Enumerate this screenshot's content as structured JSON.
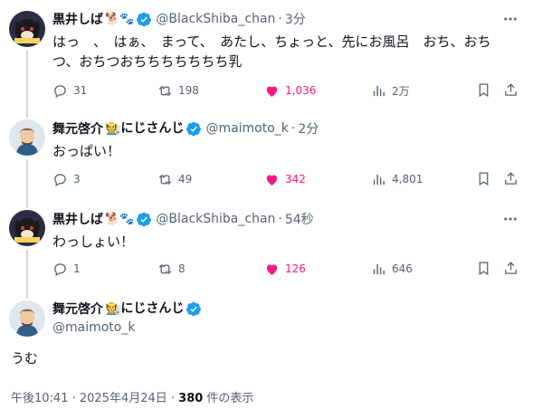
{
  "tweets": [
    {
      "name": "黒井しば",
      "emojis": "🐕🐾",
      "handle": "@BlackShiba_chan",
      "time": "3分",
      "text": "はっ　、　はぁ、　まって、　あたし、ちょっと、先にお風呂　おち、おちつ、おちつおちちちちちちち乳",
      "reply": "31",
      "retweet": "198",
      "like": "1,036",
      "views": "2万"
    },
    {
      "name": "舞元啓介",
      "emojis": "🧑‍🌾にじさんじ",
      "handle": "@maimoto_k",
      "time": "2分",
      "text": "おっぱい！",
      "reply": "3",
      "retweet": "49",
      "like": "342",
      "views": "4,801"
    },
    {
      "name": "黒井しば",
      "emojis": "🐕🐾",
      "handle": "@BlackShiba_chan",
      "time": "54秒",
      "text": "わっしょい！",
      "reply": "1",
      "retweet": "8",
      "like": "126",
      "views": "646"
    }
  ],
  "main": {
    "name": "舞元啓介",
    "emojis": "🧑‍🌾にじさんじ",
    "handle": "@maimoto_k",
    "text": "うむ",
    "timestamp": "午後10:41 · 2025年4月24日 · ",
    "view_count": "380",
    "view_suffix": " 件の表示"
  },
  "colors": {
    "verified": "#1d9bf0",
    "like": "#f91880",
    "secondary": "#536471"
  }
}
